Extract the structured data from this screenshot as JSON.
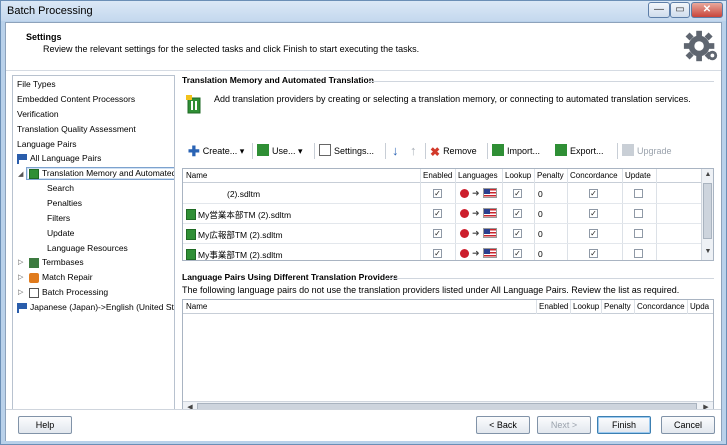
{
  "window": {
    "title": "Batch Processing",
    "min": "—",
    "max": "▭",
    "close": "✕"
  },
  "header": {
    "title": "Settings",
    "subtitle": "Review the relevant settings for the selected tasks and click Finish to start executing the tasks.",
    "icon": "gear-icon"
  },
  "nav": {
    "items": [
      "File Types",
      "Embedded Content Processors",
      "Verification",
      "Translation Quality Assessment",
      "Language Pairs",
      "All Language Pairs",
      "Translation Memory and Automated Translation",
      "Search",
      "Penalties",
      "Filters",
      "Update",
      "Language Resources",
      "Termbases",
      "Match Repair",
      "Batch Processing",
      "Japanese (Japan)->English (United St"
    ]
  },
  "tm": {
    "section_title": "Translation Memory and Automated Translation",
    "description": "Add translation providers by creating or selecting a translation memory, or connecting to automated translation services.",
    "toolbar": {
      "create": "Create...",
      "use": "Use...",
      "settings": "Settings...",
      "remove": "Remove",
      "import": "Import...",
      "export": "Export...",
      "upgrade": "Upgrade"
    },
    "columns": [
      "Name",
      "Enabled",
      "Languages",
      "Lookup",
      "Penalty",
      "Concordance",
      "Update"
    ],
    "rows": [
      {
        "name": "(2).sdltm",
        "enabled": "✓",
        "lookup": "✓",
        "penalty": "0",
        "concordance": "✓",
        "update": ""
      },
      {
        "name": "My営業本部TM (2).sdltm",
        "enabled": "✓",
        "lookup": "✓",
        "penalty": "0",
        "concordance": "✓",
        "update": ""
      },
      {
        "name": "My広報部TM (2).sdltm",
        "enabled": "✓",
        "lookup": "✓",
        "penalty": "0",
        "concordance": "✓",
        "update": ""
      },
      {
        "name": "My事業部TM (2).sdltm",
        "enabled": "✓",
        "lookup": "✓",
        "penalty": "0",
        "concordance": "✓",
        "update": ""
      }
    ]
  },
  "lp": {
    "section_title": "Language Pairs Using Different Translation Providers",
    "description": "The following language pairs do not use the translation providers listed under All Language Pairs. Review the list as required.",
    "columns": [
      "Name",
      "Enabled",
      "Lookup",
      "Penalty",
      "Concordance",
      "Upda"
    ]
  },
  "footer": {
    "help": "Help",
    "back": "< Back",
    "next": "Next >",
    "finish": "Finish",
    "cancel": "Cancel"
  }
}
